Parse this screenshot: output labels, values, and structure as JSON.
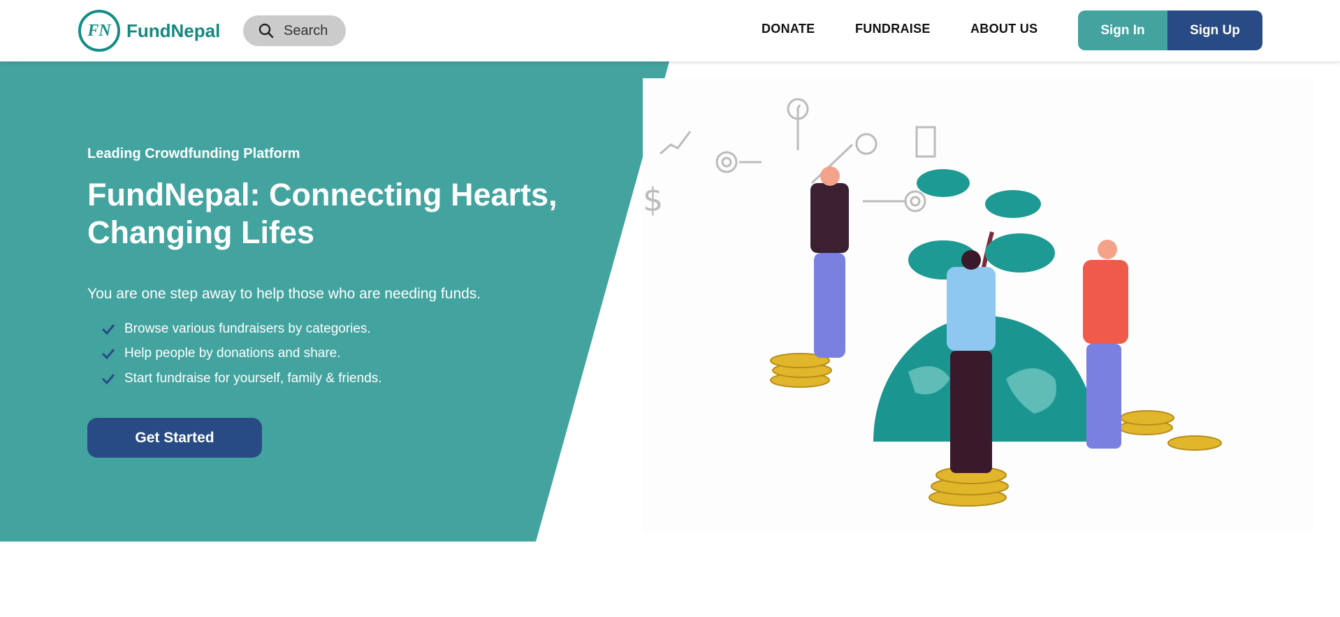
{
  "header": {
    "logo": {
      "mark": "FN",
      "name": "FundNepal"
    },
    "search": {
      "label": "Search"
    },
    "nav": [
      "DONATE",
      "FUNDRAISE",
      "ABOUT US"
    ],
    "signin": "Sign In",
    "signup": "Sign Up"
  },
  "hero": {
    "eyebrow": "Leading Crowdfunding Platform",
    "title": "FundNepal: Connecting Hearts, Changing Lifes",
    "subtitle": "You are one step away to help those who are needing funds.",
    "features": [
      "Browse various fundraisers by categories.",
      "Help people by donations and share.",
      "Start fundraise for yourself, family & friends."
    ],
    "cta": "Get Started"
  },
  "colors": {
    "teal": "#43a39f",
    "navy": "#284b85",
    "brand": "#13897f",
    "search_bg": "#cbcbcb"
  },
  "icons": [
    "search-icon",
    "check-icon"
  ]
}
